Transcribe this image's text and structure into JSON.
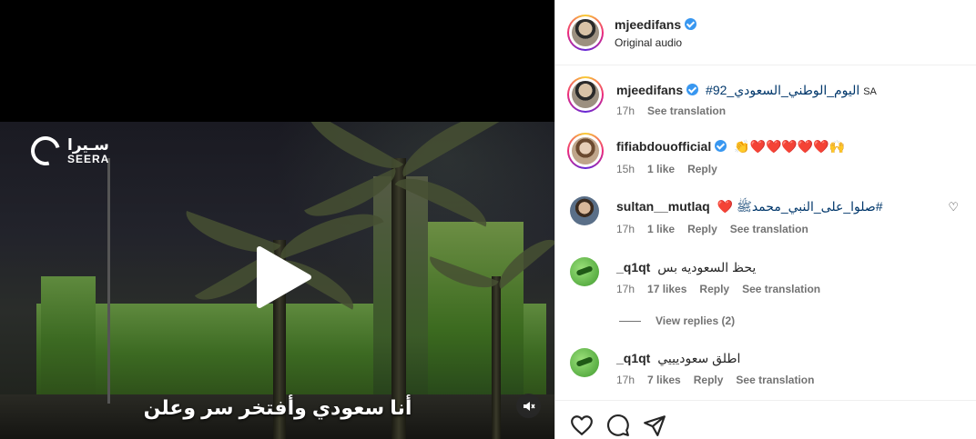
{
  "video": {
    "logo_ar": "سـيرا",
    "logo_en": "SEERA",
    "subtitle": "أنا سعودي وأفتخر سر وعلن"
  },
  "post": {
    "username": "mjeedifans",
    "audio": "Original audio"
  },
  "comments": [
    {
      "username": "mjeedifans",
      "verified": true,
      "text": "#92_اليوم_الوطني_السعودي",
      "suffix": "SA",
      "time": "17h",
      "likes": "",
      "reply": "",
      "translate": "See translation"
    },
    {
      "username": "fifiabdouofficial",
      "verified": true,
      "text": "👏❤️❤️❤️❤️❤️🙌",
      "time": "15h",
      "likes": "1 like",
      "reply": "Reply",
      "translate": ""
    },
    {
      "username": "sultan__mutlaq",
      "verified": false,
      "text": "❤️ صلوا_على_النبي_محمدﷺ#",
      "time": "17h",
      "likes": "1 like",
      "reply": "Reply",
      "translate": "See translation"
    },
    {
      "username": "_q1qt",
      "verified": false,
      "text": "يحظ السعوديه بس",
      "time": "17h",
      "likes": "17 likes",
      "reply": "Reply",
      "translate": "See translation"
    },
    {
      "username": "_q1qt",
      "verified": false,
      "text": "اطلق سعوديييي",
      "time": "17h",
      "likes": "7 likes",
      "reply": "Reply",
      "translate": "See translation"
    }
  ],
  "view_replies": "View replies (2)",
  "icons": {
    "like": "heart-icon",
    "comment": "comment-icon",
    "share": "send-icon",
    "play": "play-icon",
    "mute": "speaker-muted-icon"
  },
  "colors": {
    "verified": "#3897f0",
    "heart": "#ed2b3a",
    "link": "#00376b",
    "muted_text": "#737373"
  }
}
